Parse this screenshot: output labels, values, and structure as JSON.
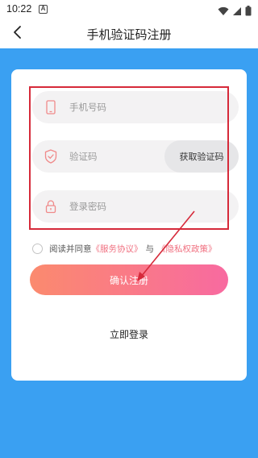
{
  "status_bar": {
    "time": "10:22",
    "app_badge": "A",
    "icons": [
      "wifi-icon",
      "signal-icon",
      "battery-icon"
    ]
  },
  "nav": {
    "title": "手机验证码注册",
    "back_icon": "chevron-left-icon"
  },
  "form": {
    "phone": {
      "placeholder": "手机号码",
      "value": "",
      "icon": "phone-icon"
    },
    "code": {
      "placeholder": "验证码",
      "value": "",
      "icon": "shield-check-icon",
      "button_label": "获取验证码"
    },
    "password": {
      "placeholder": "登录密码",
      "value": "",
      "icon": "lock-icon"
    }
  },
  "agreement": {
    "prefix": "阅读并同意",
    "service_link": "《服务协议》",
    "and": "与",
    "privacy_link": "《隐私权政策》"
  },
  "submit_label": "确认注册",
  "login_label": "立即登录",
  "colors": {
    "background_blue": "#3aa0f2",
    "button_gradient_start": "#fb8a6e",
    "button_gradient_end": "#f86aa0",
    "link_pink": "#f07080",
    "annotation_red": "#d62a3a"
  }
}
